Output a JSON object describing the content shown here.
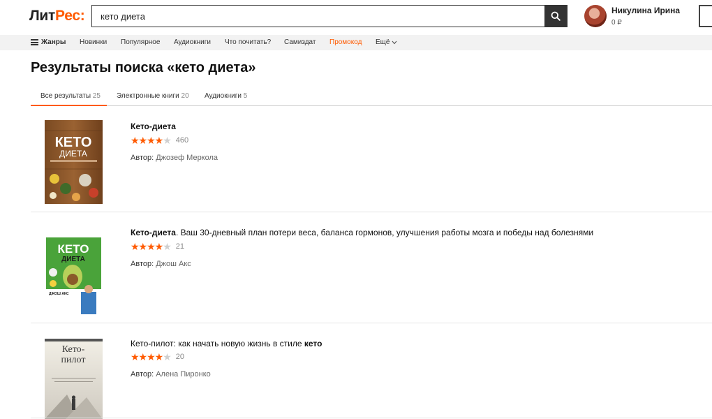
{
  "header": {
    "logo_part1": "Лит",
    "logo_part2": "Рес:",
    "search_value": "кето диета",
    "user_name": "Никулина Ирина",
    "balance": "0 ₽",
    "icons": [
      "search-icon",
      "avatar",
      "cart-icon"
    ]
  },
  "nav": {
    "genres": "Жанры",
    "items": [
      "Новинки",
      "Популярное",
      "Аудиокниги",
      "Что почитать?",
      "Самиздат",
      "Промокод",
      "Ещё"
    ],
    "promo_color": "#ff5a00"
  },
  "page": {
    "title": "Результаты поиска «кето диета»"
  },
  "tabs": [
    {
      "label": "Все результаты",
      "count": "25",
      "active": true
    },
    {
      "label": "Электронные книги",
      "count": "20",
      "active": false
    },
    {
      "label": "Аудиокниги",
      "count": "5",
      "active": false
    }
  ],
  "results": [
    {
      "title_bold": "Кето-диета",
      "title_rest": "",
      "rating_stars": 4,
      "votes": "460",
      "author_label": "Автор:",
      "author": "Джозеф Меркола",
      "cover_text_1": "КЕТО",
      "cover_text_2": "ДИЕТА"
    },
    {
      "title_bold": "Кето-диета",
      "title_rest": ". Ваш 30-дневный план потери веса, баланса гормонов, улучшения работы мозга и победы над болезнями",
      "rating_stars": 4,
      "votes": "21",
      "author_label": "Автор:",
      "author": "Джош Акс",
      "cover_text_1": "КЕТО",
      "cover_text_2": "ДИЕТА",
      "cover_text_3": "ДЖОШ АКС"
    },
    {
      "title_pre": "Кето-пилот: как начать новую жизнь в стиле ",
      "title_bold": "кето",
      "rating_stars": 4,
      "votes": "20",
      "author_label": "Автор:",
      "author": "Алена Пиронко",
      "cover_text_1": "Кето-",
      "cover_text_2": "пилот"
    }
  ],
  "colors": {
    "accent": "#ff5a00",
    "nav_bg": "#f2f2f2",
    "search_button": "#333333"
  }
}
